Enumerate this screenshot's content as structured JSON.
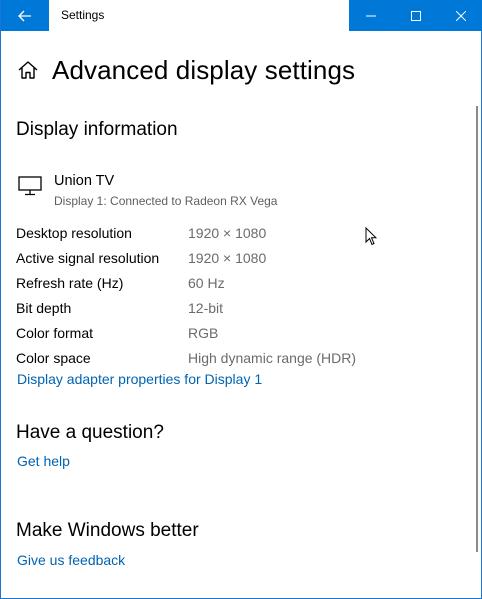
{
  "window": {
    "title": "Settings",
    "accent": "#0078d7",
    "controls": [
      "minimize-icon",
      "maximize-icon",
      "close-icon"
    ]
  },
  "header": {
    "title": "Advanced display settings",
    "icon": "home-icon"
  },
  "display_info": {
    "heading": "Display information",
    "monitor_icon": "monitor-icon",
    "monitor_name": "Union TV",
    "monitor_subtitle": "Display 1: Connected to Radeon RX Vega",
    "rows": [
      {
        "label": "Desktop resolution",
        "value": "1920 × 1080"
      },
      {
        "label": "Active signal resolution",
        "value": "1920 × 1080"
      },
      {
        "label": "Refresh rate (Hz)",
        "value": "60 Hz"
      },
      {
        "label": "Bit depth",
        "value": "12-bit"
      },
      {
        "label": "Color format",
        "value": "RGB"
      },
      {
        "label": "Color space",
        "value": "High dynamic range (HDR)"
      }
    ],
    "adapter_link": "Display adapter properties for Display 1"
  },
  "question": {
    "heading": "Have a question?",
    "link": "Get help"
  },
  "better": {
    "heading": "Make Windows better",
    "link": "Give us feedback"
  },
  "colors": {
    "link": "#0063b1",
    "secondary_text": "#6b6b6b"
  }
}
